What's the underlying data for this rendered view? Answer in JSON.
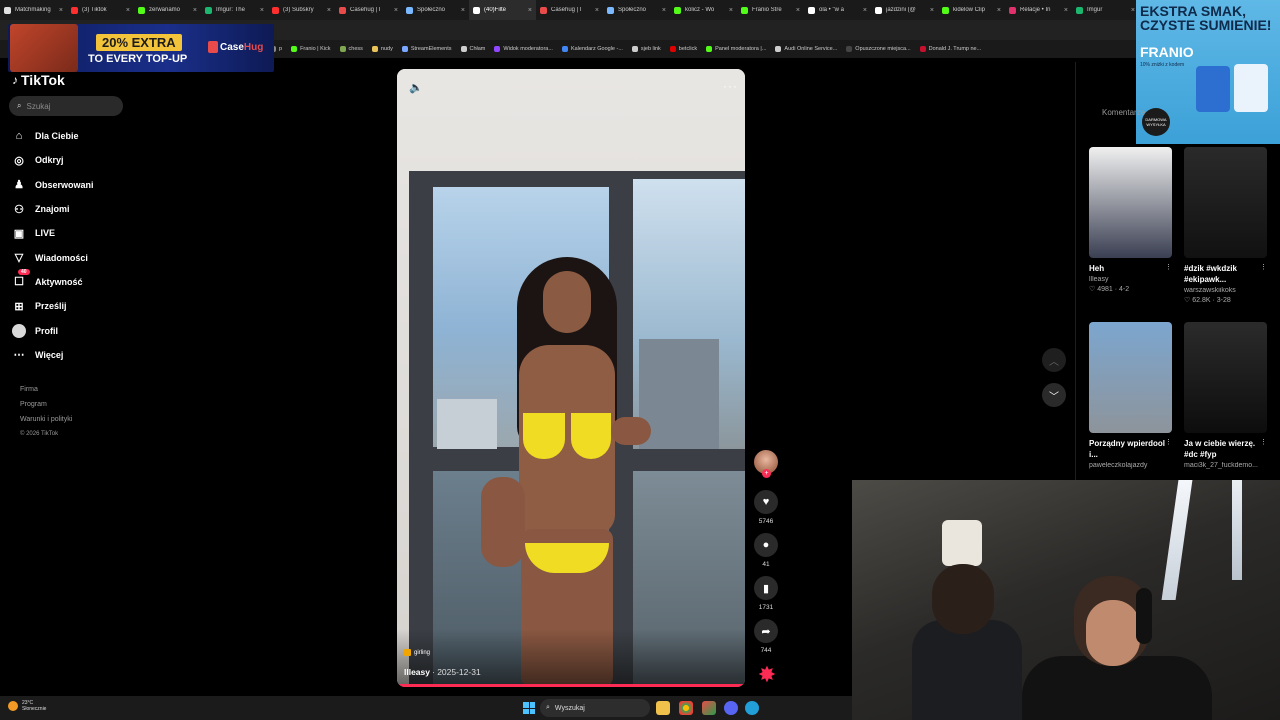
{
  "browser": {
    "tabs": [
      {
        "title": "Matchmaking",
        "color": "#e0e0e0"
      },
      {
        "title": "(3) Tiktok",
        "color": "#ff2f2f"
      },
      {
        "title": "zerwanamo",
        "color": "#53fc18"
      },
      {
        "title": "Imgur: The",
        "color": "#1bb76e"
      },
      {
        "title": "(3) Subskry",
        "color": "#ff2f2f"
      },
      {
        "title": "Casehug | I",
        "color": "#e94b4b"
      },
      {
        "title": "Społeczno",
        "color": "#7ab8ff"
      },
      {
        "title": "(40)Filte",
        "color": "#ffffff"
      },
      {
        "title": "Casehug | I",
        "color": "#e94b4b"
      },
      {
        "title": "Społeczno",
        "color": "#7ab8ff"
      },
      {
        "title": "kolicz - Wo",
        "color": "#53fc18"
      },
      {
        "title": "Franio Stre",
        "color": "#53fc18"
      },
      {
        "title": "ola • \"w a",
        "color": "#ffffff"
      },
      {
        "title": "jazdzini (@",
        "color": "#ffffff"
      },
      {
        "title": "kidelow Clip",
        "color": "#53fc18"
      },
      {
        "title": "Relacje • In",
        "color": "#e1306c"
      },
      {
        "title": "Imgur",
        "color": "#1bb76e"
      }
    ],
    "active_tab_index": 7,
    "bookmarks": [
      {
        "label": "p",
        "color": "#888888"
      },
      {
        "label": "Franio | Kick",
        "color": "#53fc18"
      },
      {
        "label": "chess",
        "color": "#7fa650"
      },
      {
        "label": "nudy",
        "color": "#e8c35a"
      },
      {
        "label": "StreamElements",
        "color": "#7aa7ff"
      },
      {
        "label": "Chłam",
        "color": "#cccccc"
      },
      {
        "label": "Widok moderatora...",
        "color": "#9146ff"
      },
      {
        "label": "Kalendarz Google -...",
        "color": "#4285f4"
      },
      {
        "label": "sjeb link",
        "color": "#cccccc"
      },
      {
        "label": "betclick",
        "color": "#e00000"
      },
      {
        "label": "Panel moderatora |...",
        "color": "#53fc18"
      },
      {
        "label": "Audi Online Service...",
        "color": "#cccccc"
      },
      {
        "label": "Opuszczone miejsca...",
        "color": "#444444"
      },
      {
        "label": "Donald J. Trump ne...",
        "color": "#c8102e"
      }
    ]
  },
  "ads": {
    "left": {
      "headline": "20% EXTRA",
      "sub": "TO EVERY TOP-UP",
      "brand_a": "Case",
      "brand_b": "Hug"
    },
    "right": {
      "headline": "EKSTRA SMAK, CZYSTE SUMIENIE!",
      "brand": "FRANIO",
      "tag": "10% zniżki z kodem",
      "badge": "DARMOWA WYSYŁKA"
    }
  },
  "tiktok": {
    "logo": "TikTok",
    "search_placeholder": "Szukaj",
    "nav": [
      {
        "label": "Dla Ciebie",
        "icon": "home-icon",
        "glyph": "⌂"
      },
      {
        "label": "Odkryj",
        "icon": "compass-icon",
        "glyph": "◎"
      },
      {
        "label": "Obserwowani",
        "icon": "user-check-icon",
        "glyph": "♟"
      },
      {
        "label": "Znajomi",
        "icon": "users-icon",
        "glyph": "⚇"
      },
      {
        "label": "LIVE",
        "icon": "live-icon",
        "glyph": "▣"
      },
      {
        "label": "Wiadomości",
        "icon": "send-icon",
        "glyph": "▽"
      },
      {
        "label": "Aktywność",
        "icon": "bell-icon",
        "glyph": "☐",
        "badge": "40"
      },
      {
        "label": "Prześlij",
        "icon": "upload-icon",
        "glyph": "⊞"
      },
      {
        "label": "Profil",
        "icon": "avatar",
        "glyph": ""
      },
      {
        "label": "Więcej",
        "icon": "more-icon",
        "glyph": "⋯"
      }
    ],
    "footer": {
      "company": "Firma",
      "program": "Program",
      "terms": "Warunki i polityki",
      "copyright": "© 2026 TikTok"
    },
    "video": {
      "music": "girling",
      "author": "llleasy",
      "date": "· 2025-12-31",
      "progress_pct": 100
    },
    "actions": {
      "likes": "5746",
      "comments": "41",
      "saves": "1731",
      "shares": "744"
    },
    "related_tab": "Komentarze",
    "related": [
      {
        "title": "Heh",
        "author": "llleasy",
        "stats": "♡ 4981 · 4-2",
        "thumb_from": "#f0f0f0",
        "thumb_to": "#3a3f52"
      },
      {
        "title": "#dzik #wkdzik #ekipawk...",
        "author": "warszawskiikoks",
        "stats": "♡ 62.8K · 3-28",
        "thumb_from": "#2a2a2a",
        "thumb_to": "#111111"
      },
      {
        "title": "Porządny wpierdool i...",
        "author": "paweleczkolajazdy",
        "stats": "",
        "thumb_from": "#7ca6cf",
        "thumb_to": "#8d949b"
      },
      {
        "title": "Ja w ciebie wierzę. #dc #fyp",
        "author": "maci3k_27_fuckdemo...",
        "stats": "",
        "thumb_from": "#2b2b2b",
        "thumb_to": "#0d0d0d"
      }
    ]
  },
  "taskbar": {
    "temp": "23°C",
    "weather": "Słonecznie",
    "search": "Wyszukaj"
  }
}
